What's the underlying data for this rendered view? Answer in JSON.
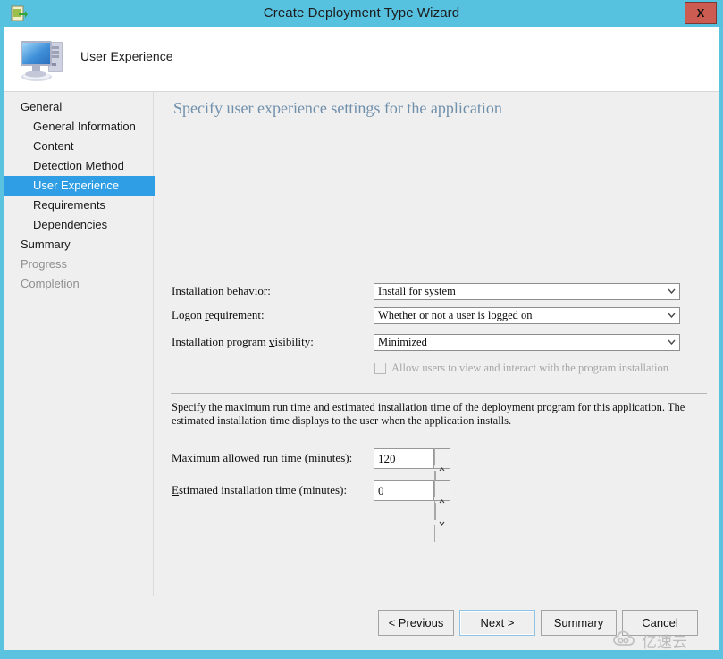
{
  "window": {
    "title": "Create Deployment Type Wizard",
    "title_icon": "deployment-type-icon",
    "close_label": "X",
    "frame_color": "#57c1e0",
    "close_color": "#cc5c51"
  },
  "header": {
    "title": "User Experience",
    "icon": "computer-icon"
  },
  "sidebar": {
    "items": [
      {
        "label": "General",
        "level": 0,
        "state": "normal"
      },
      {
        "label": "General Information",
        "level": 1,
        "state": "normal"
      },
      {
        "label": "Content",
        "level": 1,
        "state": "normal"
      },
      {
        "label": "Detection Method",
        "level": 1,
        "state": "normal"
      },
      {
        "label": "User Experience",
        "level": 1,
        "state": "selected"
      },
      {
        "label": "Requirements",
        "level": 1,
        "state": "normal"
      },
      {
        "label": "Dependencies",
        "level": 1,
        "state": "normal"
      },
      {
        "label": "Summary",
        "level": 0,
        "state": "normal"
      },
      {
        "label": "Progress",
        "level": 0,
        "state": "disabled"
      },
      {
        "label": "Completion",
        "level": 0,
        "state": "disabled"
      }
    ],
    "selected_color": "#2f9ee4"
  },
  "content": {
    "heading": "Specify user experience settings for the application",
    "heading_color": "#6f8fab",
    "fields": [
      {
        "label_pre": "Installati",
        "label_acc": "o",
        "label_post": "n behavior:",
        "value": "Install for system"
      },
      {
        "label_pre": "Logon ",
        "label_acc": "r",
        "label_post": "equirement:",
        "value": "Whether or not a user is logged on"
      },
      {
        "label_pre": "Installation program ",
        "label_acc": "v",
        "label_post": "isibility:",
        "value": "Minimized"
      }
    ],
    "allow_checkbox": {
      "label": "Allow users to view and interact with the program installation",
      "checked": false,
      "enabled": false
    },
    "description": "Specify the maximum run time and estimated installation time of the deployment program for this application. The estimated installation time displays to the user when the application installs.",
    "spinners": [
      {
        "label_pre": "",
        "label_acc": "M",
        "label_post": "aximum allowed run time (minutes):",
        "value": "120"
      },
      {
        "label_pre": "",
        "label_acc": "E",
        "label_post": "stimated installation time (minutes):",
        "value": "0"
      }
    ]
  },
  "footer": {
    "buttons": [
      {
        "label": "< Previous",
        "focused": false
      },
      {
        "label": "Next >",
        "focused": true
      },
      {
        "label": "Summary",
        "focused": false
      },
      {
        "label": "Cancel",
        "focused": false
      }
    ]
  },
  "watermark": {
    "text": "亿速云",
    "logo": "cloud-icon"
  }
}
